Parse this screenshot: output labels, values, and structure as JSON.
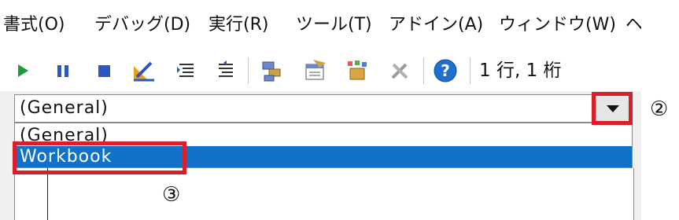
{
  "menu": [
    {
      "label": "書式(O)"
    },
    {
      "label": "デバッグ(D)"
    },
    {
      "label": "実行(R)"
    },
    {
      "label": "ツール(T)"
    },
    {
      "label": "アドイン(A)"
    },
    {
      "label": "ウィンドウ(W)"
    },
    {
      "label": "ヘ"
    }
  ],
  "toolbar": {
    "icons": [
      "run-icon",
      "break-icon",
      "reset-icon",
      "design-mode-icon",
      "indent-icon",
      "outdent-icon",
      "project-explorer-icon",
      "properties-icon",
      "object-browser-icon",
      "toolbox-icon",
      "help-icon"
    ],
    "position": "1 行, 1 桁"
  },
  "object_combo": {
    "value": "(General)",
    "options": [
      "(General)",
      "Workbook"
    ],
    "selected": "Workbook"
  },
  "callouts": {
    "step2": "②",
    "step3": "③"
  },
  "colors": {
    "highlight": "#0f72c8",
    "annotation": "#d7202a"
  }
}
